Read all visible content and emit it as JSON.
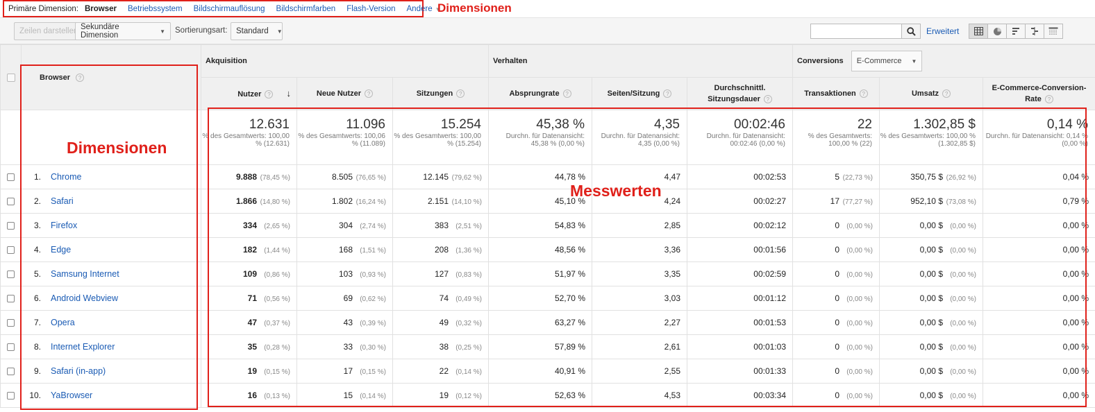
{
  "primary": {
    "label": "Primäre Dimension:",
    "current": "Browser",
    "links": [
      "Betriebssystem",
      "Bildschirmauflösung",
      "Bildschirmfarben",
      "Flash-Version"
    ],
    "more": "Andere"
  },
  "annotations": {
    "top": "Dimensionen",
    "left": "Dimensionen",
    "metrics": "Messwerten"
  },
  "toolbar": {
    "plot_rows": "Zeilen darstellen",
    "secondary_dimension": "Sekundäre Dimension",
    "sort_label": "Sortierungsart:",
    "sort_value": "Standard",
    "search_placeholder": "",
    "advanced": "Erweitert"
  },
  "groups": {
    "acquisition": "Akquisition",
    "behavior": "Verhalten",
    "conversions": "Conversions",
    "conversions_select": "E-Commerce"
  },
  "columns": {
    "browser": "Browser",
    "users": "Nutzer",
    "new_users": "Neue Nutzer",
    "sessions": "Sitzungen",
    "bounce_rate": "Absprungrate",
    "pages_session": "Seiten/Sitzung",
    "avg_duration_1": "Durchschnittl.",
    "avg_duration_2": "Sitzungsdauer",
    "transactions": "Transaktionen",
    "revenue": "Umsatz",
    "conv_rate_1": "E-Commerce-Conversion-",
    "conv_rate_2": "Rate"
  },
  "totals": {
    "users": {
      "value": "12.631",
      "sub": "% des Gesamtwerts: 100,00 % (12.631)"
    },
    "new_users": {
      "value": "11.096",
      "sub": "% des Gesamtwerts: 100,06 % (11.089)"
    },
    "sessions": {
      "value": "15.254",
      "sub": "% des Gesamtwerts: 100,00 % (15.254)"
    },
    "bounce_rate": {
      "value": "45,38 %",
      "sub": "Durchn. für Datenansicht: 45,38 % (0,00 %)"
    },
    "pages_session": {
      "value": "4,35",
      "sub": "Durchn. für Datenansicht: 4,35 (0,00 %)"
    },
    "avg_duration": {
      "value": "00:02:46",
      "sub": "Durchn. für Datenansicht: 00:02:46 (0,00 %)"
    },
    "transactions": {
      "value": "22",
      "sub": "% des Gesamtwerts: 100,00 % (22)"
    },
    "revenue": {
      "value": "1.302,85 $",
      "sub": "% des Gesamtwerts: 100,00 % (1.302,85 $)"
    },
    "conv_rate": {
      "value": "0,14 %",
      "sub": "Durchn. für Datenansicht: 0,14 % (0,00 %)"
    }
  },
  "rows": [
    {
      "rank": "1.",
      "browser": "Chrome",
      "users": "9.888",
      "users_pct": "(78,45 %)",
      "new_users": "8.505",
      "new_users_pct": "(76,65 %)",
      "sessions": "12.145",
      "sessions_pct": "(79,62 %)",
      "bounce": "44,78 %",
      "pages": "4,47",
      "duration": "00:02:53",
      "transactions": "5",
      "transactions_pct": "(22,73 %)",
      "revenue": "350,75 $",
      "revenue_pct": "(26,92 %)",
      "conv": "0,04 %"
    },
    {
      "rank": "2.",
      "browser": "Safari",
      "users": "1.866",
      "users_pct": "(14,80 %)",
      "new_users": "1.802",
      "new_users_pct": "(16,24 %)",
      "sessions": "2.151",
      "sessions_pct": "(14,10 %)",
      "bounce": "45,10 %",
      "pages": "4,24",
      "duration": "00:02:27",
      "transactions": "17",
      "transactions_pct": "(77,27 %)",
      "revenue": "952,10 $",
      "revenue_pct": "(73,08 %)",
      "conv": "0,79 %"
    },
    {
      "rank": "3.",
      "browser": "Firefox",
      "users": "334",
      "users_pct": "(2,65 %)",
      "new_users": "304",
      "new_users_pct": "(2,74 %)",
      "sessions": "383",
      "sessions_pct": "(2,51 %)",
      "bounce": "54,83 %",
      "pages": "2,85",
      "duration": "00:02:12",
      "transactions": "0",
      "transactions_pct": "(0,00 %)",
      "revenue": "0,00 $",
      "revenue_pct": "(0,00 %)",
      "conv": "0,00 %"
    },
    {
      "rank": "4.",
      "browser": "Edge",
      "users": "182",
      "users_pct": "(1,44 %)",
      "new_users": "168",
      "new_users_pct": "(1,51 %)",
      "sessions": "208",
      "sessions_pct": "(1,36 %)",
      "bounce": "48,56 %",
      "pages": "3,36",
      "duration": "00:01:56",
      "transactions": "0",
      "transactions_pct": "(0,00 %)",
      "revenue": "0,00 $",
      "revenue_pct": "(0,00 %)",
      "conv": "0,00 %"
    },
    {
      "rank": "5.",
      "browser": "Samsung Internet",
      "users": "109",
      "users_pct": "(0,86 %)",
      "new_users": "103",
      "new_users_pct": "(0,93 %)",
      "sessions": "127",
      "sessions_pct": "(0,83 %)",
      "bounce": "51,97 %",
      "pages": "3,35",
      "duration": "00:02:59",
      "transactions": "0",
      "transactions_pct": "(0,00 %)",
      "revenue": "0,00 $",
      "revenue_pct": "(0,00 %)",
      "conv": "0,00 %"
    },
    {
      "rank": "6.",
      "browser": "Android Webview",
      "users": "71",
      "users_pct": "(0,56 %)",
      "new_users": "69",
      "new_users_pct": "(0,62 %)",
      "sessions": "74",
      "sessions_pct": "(0,49 %)",
      "bounce": "52,70 %",
      "pages": "3,03",
      "duration": "00:01:12",
      "transactions": "0",
      "transactions_pct": "(0,00 %)",
      "revenue": "0,00 $",
      "revenue_pct": "(0,00 %)",
      "conv": "0,00 %"
    },
    {
      "rank": "7.",
      "browser": "Opera",
      "users": "47",
      "users_pct": "(0,37 %)",
      "new_users": "43",
      "new_users_pct": "(0,39 %)",
      "sessions": "49",
      "sessions_pct": "(0,32 %)",
      "bounce": "63,27 %",
      "pages": "2,27",
      "duration": "00:01:53",
      "transactions": "0",
      "transactions_pct": "(0,00 %)",
      "revenue": "0,00 $",
      "revenue_pct": "(0,00 %)",
      "conv": "0,00 %"
    },
    {
      "rank": "8.",
      "browser": "Internet Explorer",
      "users": "35",
      "users_pct": "(0,28 %)",
      "new_users": "33",
      "new_users_pct": "(0,30 %)",
      "sessions": "38",
      "sessions_pct": "(0,25 %)",
      "bounce": "57,89 %",
      "pages": "2,61",
      "duration": "00:01:03",
      "transactions": "0",
      "transactions_pct": "(0,00 %)",
      "revenue": "0,00 $",
      "revenue_pct": "(0,00 %)",
      "conv": "0,00 %"
    },
    {
      "rank": "9.",
      "browser": "Safari (in-app)",
      "users": "19",
      "users_pct": "(0,15 %)",
      "new_users": "17",
      "new_users_pct": "(0,15 %)",
      "sessions": "22",
      "sessions_pct": "(0,14 %)",
      "bounce": "40,91 %",
      "pages": "2,55",
      "duration": "00:01:33",
      "transactions": "0",
      "transactions_pct": "(0,00 %)",
      "revenue": "0,00 $",
      "revenue_pct": "(0,00 %)",
      "conv": "0,00 %"
    },
    {
      "rank": "10.",
      "browser": "YaBrowser",
      "users": "16",
      "users_pct": "(0,13 %)",
      "new_users": "15",
      "new_users_pct": "(0,14 %)",
      "sessions": "19",
      "sessions_pct": "(0,12 %)",
      "bounce": "52,63 %",
      "pages": "4,53",
      "duration": "00:03:34",
      "transactions": "0",
      "transactions_pct": "(0,00 %)",
      "revenue": "0,00 $",
      "revenue_pct": "(0,00 %)",
      "conv": "0,00 %"
    }
  ],
  "colors": {
    "accent_red": "#e0201a",
    "link_blue": "#1a5bb4"
  }
}
